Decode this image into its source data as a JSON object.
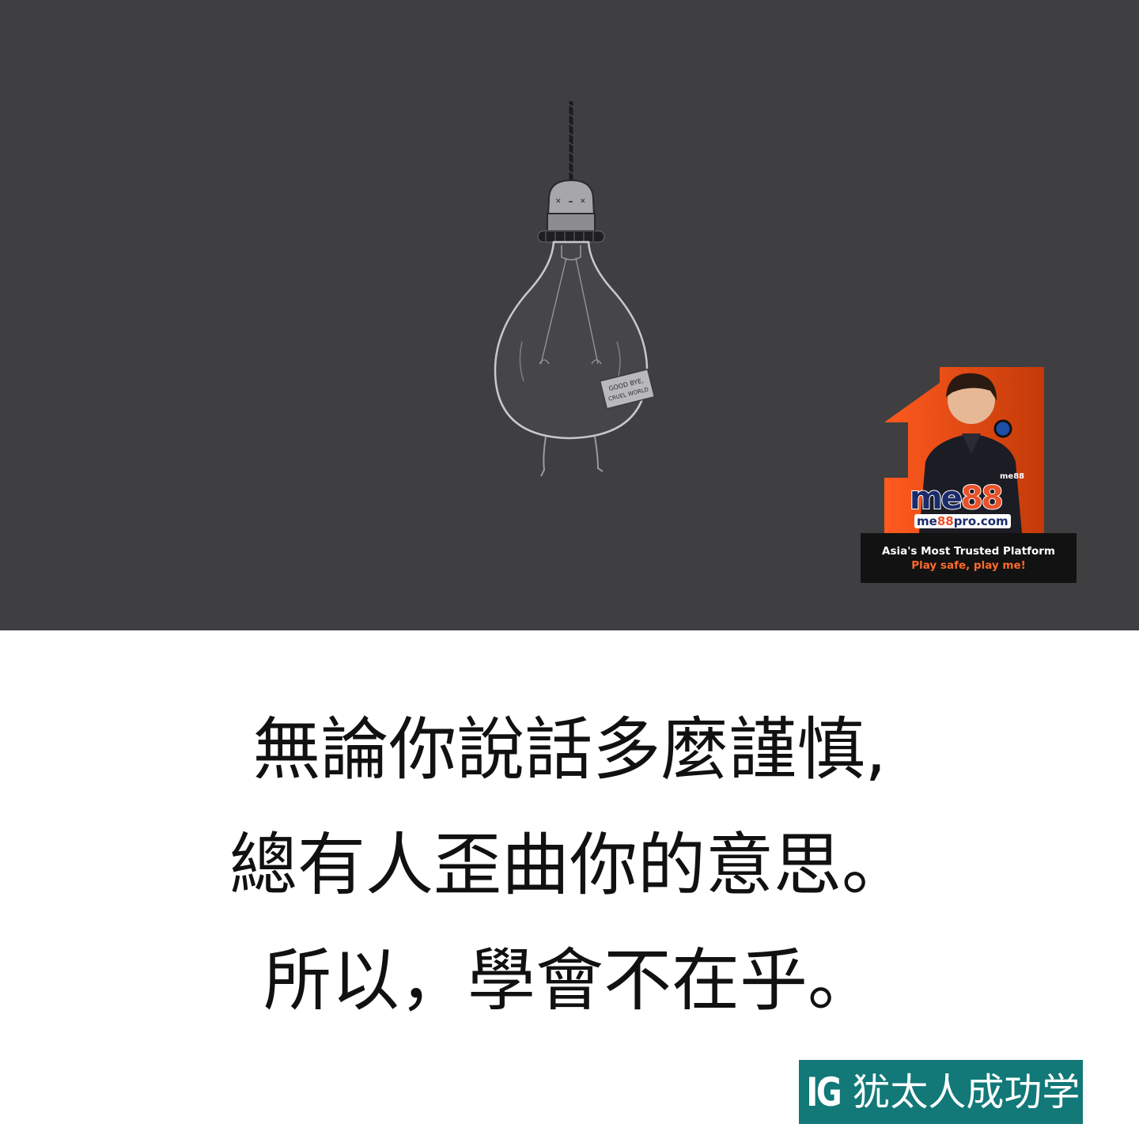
{
  "illustration": {
    "sign_text_line1": "GOOD BYE,",
    "sign_text_line2": "CRUEL WORLD",
    "subject": "hanging-light-bulb"
  },
  "ad": {
    "brand_prefix": "me",
    "brand_suffix": "88",
    "url_prefix": "me",
    "url_accent": "88",
    "url_suffix": "pro.com",
    "mini_logo": "me88",
    "tagline": "Asia's Most Trusted Platform",
    "slogan": "Play safe, play me!",
    "colors": {
      "accent": "#ff5a1f",
      "banner": "#121212",
      "brand": "#1a2b6b"
    }
  },
  "quote": {
    "line1": "無論你說話多麼謹慎,",
    "line2": "總有人歪曲你的意思。",
    "line3": "所以，學會不在乎。"
  },
  "badge": {
    "mark": "IG",
    "name": "犹太人成功学",
    "color": "#127878"
  }
}
